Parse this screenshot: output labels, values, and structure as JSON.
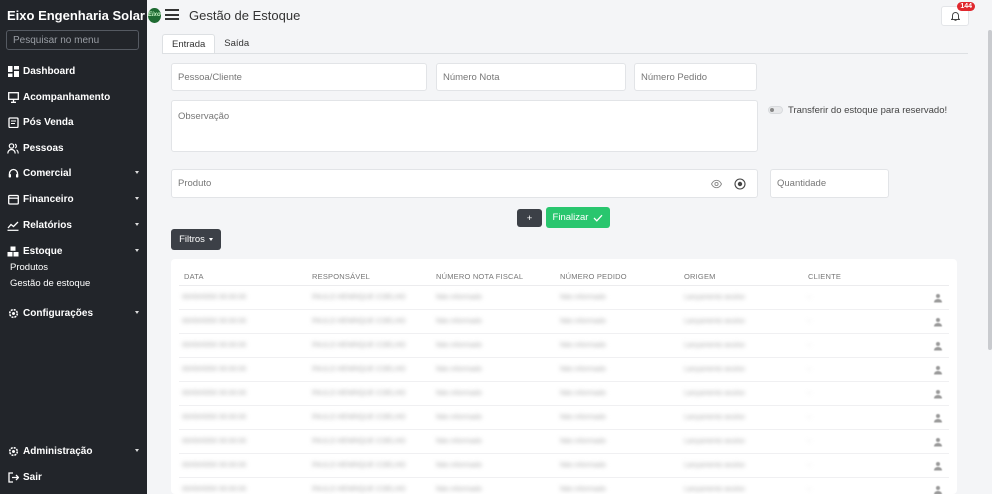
{
  "sidebar": {
    "brand": "Eixo Engenharia Solar",
    "brand_logo_text": "Eixo",
    "search_placeholder": "Pesquisar no menu",
    "items": [
      {
        "label": "Dashboard",
        "icon": "dashboard-icon"
      },
      {
        "label": "Acompanhamento",
        "icon": "monitor-icon"
      },
      {
        "label": "Pós Venda",
        "icon": "clipboard-icon"
      },
      {
        "label": "Pessoas",
        "icon": "people-icon"
      },
      {
        "label": "Comercial",
        "icon": "headset-icon"
      },
      {
        "label": "Financeiro",
        "icon": "wallet-icon"
      },
      {
        "label": "Relatórios",
        "icon": "chart-line-icon"
      },
      {
        "label": "Estoque",
        "icon": "boxes-icon"
      },
      {
        "label": "Configurações",
        "icon": "gear-icon"
      },
      {
        "label": "Administração",
        "icon": "gear-icon"
      },
      {
        "label": "Sair",
        "icon": "logout-icon"
      }
    ],
    "estoque_sub": [
      "Produtos",
      "Gestão de estoque"
    ]
  },
  "header": {
    "title": "Gestão de Estoque",
    "notification_count": "144"
  },
  "tabs": [
    "Entrada",
    "Saída"
  ],
  "form": {
    "pessoa_placeholder": "Pessoa/Cliente",
    "nota_placeholder": "Número Nota",
    "pedido_placeholder": "Número Pedido",
    "observacao_placeholder": "Observação",
    "toggle_label": "Transferir do estoque para reservado!",
    "produto_placeholder": "Produto",
    "quantidade_placeholder": "Quantidade",
    "add_label": "+",
    "finalizar_label": "Finalizar",
    "filtros_label": "Filtros"
  },
  "table": {
    "headers": [
      "DATA",
      "RESPONSÁVEL",
      "NÚMERO NOTA FISCAL",
      "NÚMERO PEDIDO",
      "ORIGEM",
      "CLIENTE"
    ],
    "rows": [
      [
        "00/00/0000 00:00:00",
        "PAULO HENRIQUE COELHO",
        "Não informado",
        "Não informado",
        "Lançamento avulso",
        "-"
      ],
      [
        "00/00/0000 00:00:00",
        "PAULO HENRIQUE COELHO",
        "Não informado",
        "Não informado",
        "Lançamento avulso",
        "-"
      ],
      [
        "00/00/0000 00:00:00",
        "PAULO HENRIQUE COELHO",
        "Não informado",
        "Não informado",
        "Lançamento avulso",
        "-"
      ],
      [
        "00/00/0000 00:00:00",
        "PAULO HENRIQUE COELHO",
        "Não informado",
        "Não informado",
        "Lançamento avulso",
        "-"
      ],
      [
        "00/00/0000 00:00:00",
        "PAULO HENRIQUE COELHO",
        "Não informado",
        "Não informado",
        "Lançamento avulso",
        "-"
      ],
      [
        "00/00/0000 00:00:00",
        "PAULO HENRIQUE COELHO",
        "Não informado",
        "Não informado",
        "Lançamento avulso",
        "-"
      ],
      [
        "00/00/0000 00:00:00",
        "PAULO HENRIQUE COELHO",
        "Não informado",
        "Não informado",
        "Lançamento avulso",
        "-"
      ],
      [
        "00/00/0000 00:00:00",
        "PAULO HENRIQUE COELHO",
        "Não informado",
        "Não informado",
        "Lançamento avulso",
        "-"
      ],
      [
        "00/00/0000 00:00:00",
        "PAULO HENRIQUE COELHO",
        "Não informado",
        "Não informado",
        "Lançamento avulso",
        "-"
      ]
    ]
  },
  "colors": {
    "sidebar_bg": "#22252a",
    "accent_green": "#29c66e",
    "badge_red": "#e0282e",
    "dark_button": "#3c4047"
  }
}
